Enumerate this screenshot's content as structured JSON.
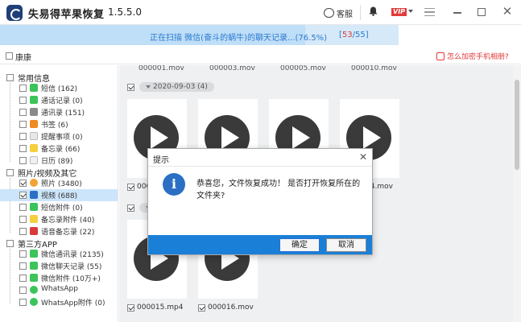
{
  "app": {
    "title": "失易得苹果恢复",
    "version": "1.5.5.0",
    "support_label": "客服",
    "vip_label": "VIP"
  },
  "progress": {
    "text": "正在扫描 微信(奋斗的蜗牛)的聊天记录...(76.5%)",
    "percent": 76.5,
    "current": "53",
    "total": "55"
  },
  "device": {
    "name": "康康",
    "encrypt_link": "怎么加密手机相册?"
  },
  "sidebar": {
    "categories": [
      {
        "label": "常用信息",
        "items": [
          {
            "label": "短信 (162)",
            "icon": "sms-icon",
            "color": "#3cc45a"
          },
          {
            "label": "通话记录 (0)",
            "icon": "phone-icon",
            "color": "#3cc45a"
          },
          {
            "label": "通讯录 (151)",
            "icon": "contacts-icon",
            "color": "#8a8a8a"
          },
          {
            "label": "书签 (6)",
            "icon": "bookmark-icon",
            "color": "#f08a24"
          },
          {
            "label": "提醒事项 (0)",
            "icon": "reminder-icon",
            "color": "#d8d8d8"
          },
          {
            "label": "备忘录 (66)",
            "icon": "notes-icon",
            "color": "#f4d03f"
          },
          {
            "label": "日历 (89)",
            "icon": "calendar-icon",
            "color": "#e0e0e0"
          }
        ]
      },
      {
        "label": "照片/视频及其它",
        "items": [
          {
            "label": "照片 (3480)",
            "icon": "photos-icon",
            "color": "#f4a236"
          },
          {
            "label": "视频 (688)",
            "icon": "video-icon",
            "color": "#2b6fc4"
          },
          {
            "label": "短信附件 (0)",
            "icon": "sms-attachment-icon",
            "color": "#3cc45a"
          },
          {
            "label": "备忘录附件 (40)",
            "icon": "notes-attachment-icon",
            "color": "#f4d03f"
          },
          {
            "label": "语音备忘录 (22)",
            "icon": "voice-memo-icon",
            "color": "#d83a3a"
          }
        ]
      },
      {
        "label": "第三方APP",
        "items": [
          {
            "label": "微信通讯录 (2135)",
            "icon": "wechat-contacts-icon",
            "color": "#3cc45a"
          },
          {
            "label": "微信聊天记录 (55)",
            "icon": "wechat-chat-icon",
            "color": "#3cc45a"
          },
          {
            "label": "微信附件 (10万+)",
            "icon": "wechat-attachment-icon",
            "color": "#3cc45a"
          },
          {
            "label": "WhatsApp",
            "icon": "whatsapp-icon",
            "color": "#3cc45a"
          },
          {
            "label": "WhatsApp附件 (0)",
            "icon": "whatsapp-attachment-icon",
            "color": "#3cc45a"
          }
        ]
      }
    ]
  },
  "content": {
    "top_labels": [
      "000001.mov",
      "000003.mov",
      "000005.mov",
      "000010.mov"
    ],
    "group1": {
      "date": "2020-09-03 (4)",
      "labels": [
        "000",
        "",
        "",
        "14.mov"
      ]
    },
    "group2": {
      "labels": [
        "000015.mp4",
        "000016.mov"
      ]
    }
  },
  "dialog": {
    "title": "提示",
    "message": "恭喜您，文件恢复成功！ 是否打开恢复所在的文件夹?",
    "ok_label": "确定",
    "cancel_label": "取消"
  },
  "colors": {
    "accent": "#1a7fd6",
    "progress_bg": "#d5e9f9",
    "alert": "#e23a3a"
  }
}
